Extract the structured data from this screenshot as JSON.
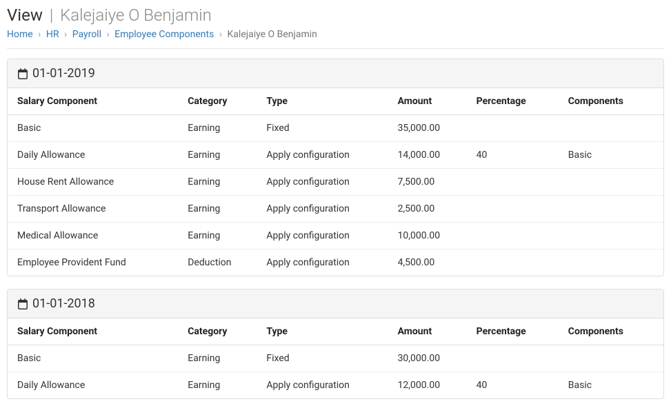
{
  "header": {
    "title_label": "View",
    "title_separator": "|",
    "subtitle": "Kalejaiye O Benjamin"
  },
  "breadcrumb": {
    "home": "Home",
    "hr": "HR",
    "payroll": "Payroll",
    "employee_components": "Employee Components",
    "current": "Kalejaiye O Benjamin",
    "sep": "›"
  },
  "columns": {
    "salary_component": "Salary Component",
    "category": "Category",
    "type": "Type",
    "amount": "Amount",
    "percentage": "Percentage",
    "components": "Components"
  },
  "periods": [
    {
      "date": "01-01-2019",
      "rows": [
        {
          "salary_component": "Basic",
          "category": "Earning",
          "type": "Fixed",
          "amount": "35,000.00",
          "percentage": "",
          "components": ""
        },
        {
          "salary_component": "Daily Allowance",
          "category": "Earning",
          "type": "Apply configuration",
          "amount": "14,000.00",
          "percentage": "40",
          "components": "Basic"
        },
        {
          "salary_component": "House Rent Allowance",
          "category": "Earning",
          "type": "Apply configuration",
          "amount": "7,500.00",
          "percentage": "",
          "components": ""
        },
        {
          "salary_component": "Transport Allowance",
          "category": "Earning",
          "type": "Apply configuration",
          "amount": "2,500.00",
          "percentage": "",
          "components": ""
        },
        {
          "salary_component": "Medical Allowance",
          "category": "Earning",
          "type": "Apply configuration",
          "amount": "10,000.00",
          "percentage": "",
          "components": ""
        },
        {
          "salary_component": "Employee Provident Fund",
          "category": "Deduction",
          "type": "Apply configuration",
          "amount": "4,500.00",
          "percentage": "",
          "components": ""
        }
      ]
    },
    {
      "date": "01-01-2018",
      "rows": [
        {
          "salary_component": "Basic",
          "category": "Earning",
          "type": "Fixed",
          "amount": "30,000.00",
          "percentage": "",
          "components": ""
        },
        {
          "salary_component": "Daily Allowance",
          "category": "Earning",
          "type": "Apply configuration",
          "amount": "12,000.00",
          "percentage": "40",
          "components": "Basic"
        }
      ]
    }
  ]
}
